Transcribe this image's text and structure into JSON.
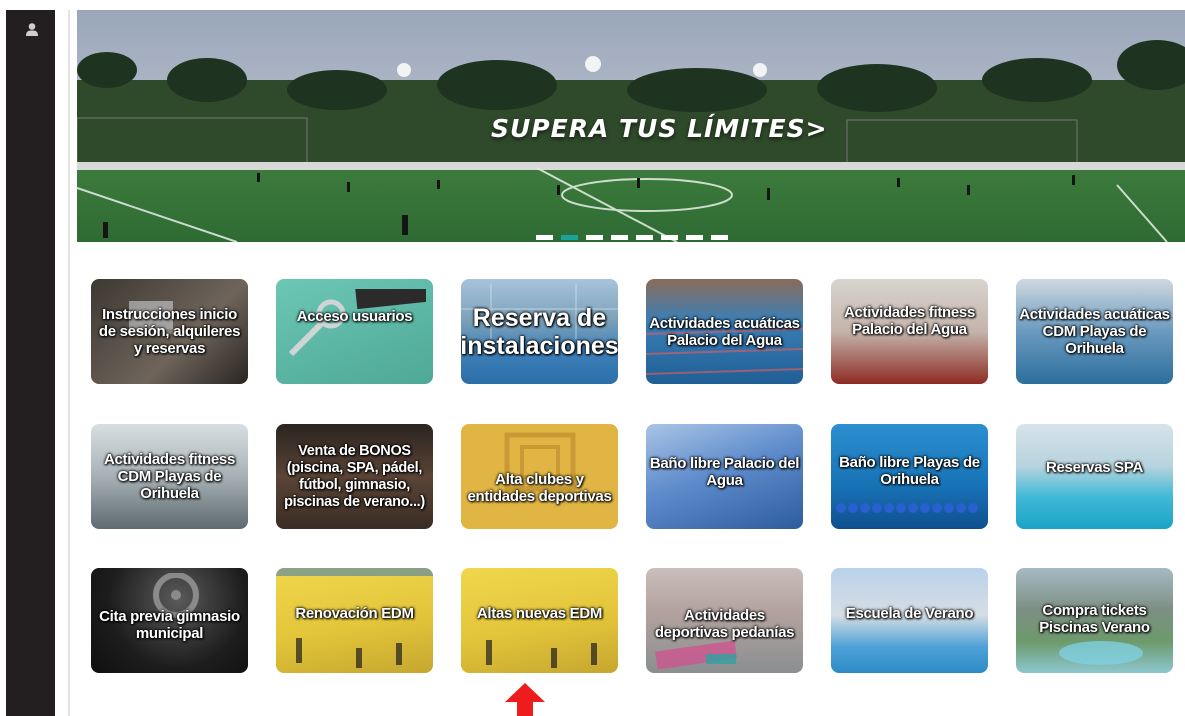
{
  "banner": {
    "caption": "SUPERA TUS LÍMITES>",
    "slides": 8,
    "active_slide": 2
  },
  "tiles": [
    {
      "label": "Instrucciones inicio de sesión, alquileres y reservas",
      "color": "#5a524b"
    },
    {
      "label": "Acceso usuarios",
      "color": "#5fb7a6"
    },
    {
      "label": "Reserva de instalaciones",
      "color": "#7a98a8"
    },
    {
      "label": "Actividades acuáticas Palacio del Agua",
      "color": "#2e6f9f"
    },
    {
      "label": "Actividades fitness Palacio del Agua",
      "color": "#a0807a"
    },
    {
      "label": "Actividades acuáticas CDM Playas de Orihuela",
      "color": "#4f88a8"
    },
    {
      "label": "Actividades fitness CDM Playas de Orihuela",
      "color": "#8d9aa0"
    },
    {
      "label": "Venta de BONOS (piscina, SPA, pádel, fútbol, gimnasio, piscinas de verano...)",
      "color": "#4a3a30"
    },
    {
      "label": "Alta clubes y entidades deportivas",
      "color": "#e0b544"
    },
    {
      "label": "Baño libre Palacio del Agua",
      "color": "#5d8bc6"
    },
    {
      "label": "Baño libre Playas de Orihuela",
      "color": "#1e86c4"
    },
    {
      "label": "Reservas SPA",
      "color": "#52c6db"
    },
    {
      "label": "Cita previa gimnasio municipal",
      "color": "#272727"
    },
    {
      "label": "Renovación EDM",
      "color": "#e3c53a"
    },
    {
      "label": "Altas nuevas EDM",
      "color": "#e3c53a"
    },
    {
      "label": "Actividades deportivas pedanías",
      "color": "#a79a95"
    },
    {
      "label": "Escuela de Verano",
      "color": "#6f9ec8"
    },
    {
      "label": "Compra tickets Piscinas Verano",
      "color": "#5f8b86"
    }
  ],
  "annotation": {
    "arrow_color": "#ee1c1c"
  }
}
